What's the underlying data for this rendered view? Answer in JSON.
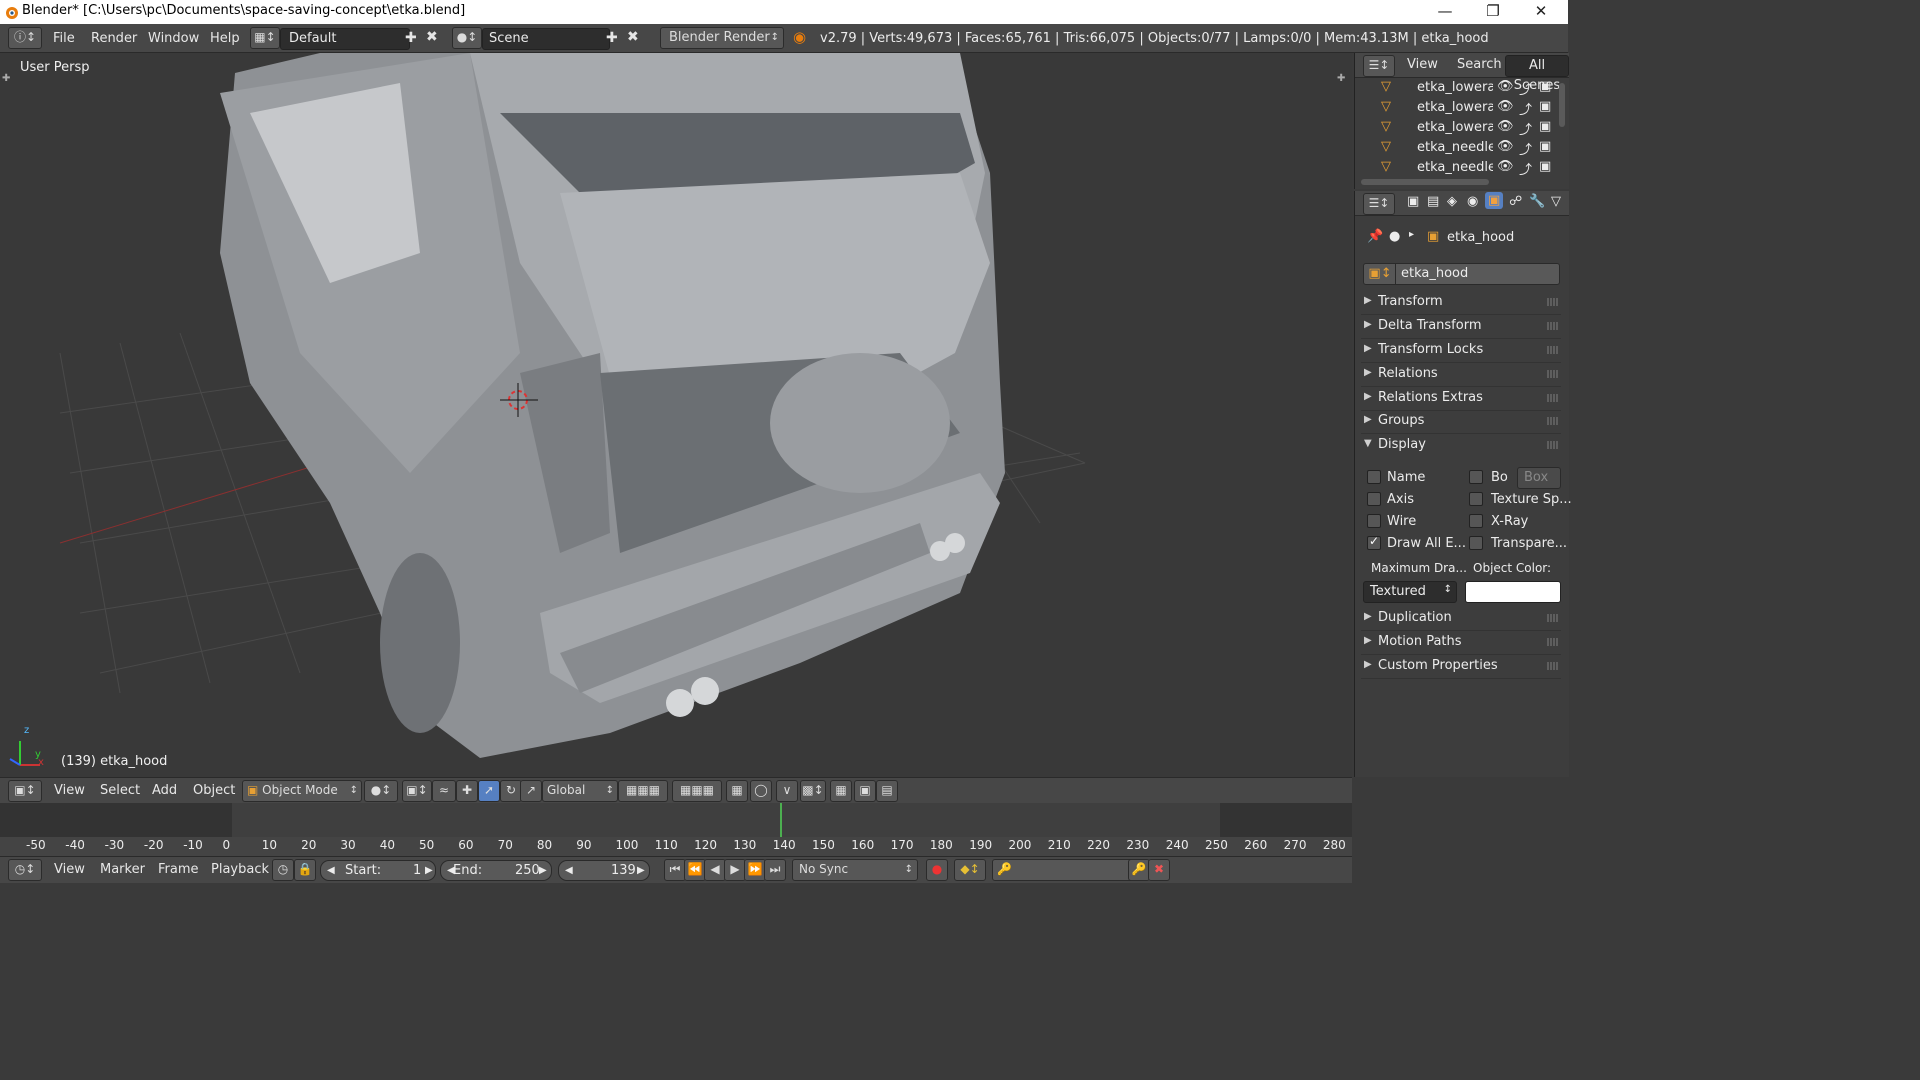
{
  "window": {
    "title": "Blender* [C:\\Users\\pc\\Documents\\space-saving-concept\\etka.blend]",
    "minimize": "—",
    "maximize": "❐",
    "close": "✕"
  },
  "info_header": {
    "menus": [
      "File",
      "Render",
      "Window",
      "Help"
    ],
    "layout": "Default",
    "scene": "Scene",
    "engine": "Blender Render",
    "stats": "v2.79 | Verts:49,673 | Faces:65,761 | Tris:66,075 | Objects:0/77 | Lamps:0/0 | Mem:43.13M | etka_hood"
  },
  "viewport": {
    "view_label": "User Persp",
    "object_label": "(139) etka_hood",
    "axis_x": "x",
    "axis_y": "y",
    "axis_z": "z"
  },
  "outliner": {
    "tabs": [
      "View",
      "Search",
      "All Scenes"
    ],
    "items": [
      "etka_lowerarn",
      "etka_lowerarn",
      "etka_lowerarn",
      "etka_needle_",
      "etka_needle_"
    ]
  },
  "properties": {
    "breadcrumb": "etka_hood",
    "object_name": "etka_hood",
    "panels_top": [
      "Transform",
      "Delta Transform",
      "Transform Locks",
      "Relations",
      "Relations Extras",
      "Groups"
    ],
    "display_panel": "Display",
    "display_left": [
      {
        "label": "Name",
        "checked": false
      },
      {
        "label": "Axis",
        "checked": false
      },
      {
        "label": "Wire",
        "checked": false
      },
      {
        "label": "Draw All E...",
        "checked": true
      }
    ],
    "display_right": [
      {
        "label": "Bo",
        "checked": false
      },
      {
        "label": "Texture Sp...",
        "checked": false
      },
      {
        "label": "X-Ray",
        "checked": false
      },
      {
        "label": "Transpare...",
        "checked": false
      }
    ],
    "bounds_type": "Box",
    "max_draw_label": "Maximum Dra...",
    "max_draw_value": "Textured",
    "object_color_label": "Object Color:",
    "object_color": "#ffffff",
    "panels_bottom": [
      "Duplication",
      "Motion Paths",
      "Custom Properties"
    ]
  },
  "viewport_header": {
    "menus": [
      "View",
      "Select",
      "Add",
      "Object"
    ],
    "mode": "Object Mode",
    "orientation": "Global"
  },
  "timeline": {
    "ticks": [
      "-50",
      "-40",
      "-30",
      "-20",
      "-10",
      "0",
      "10",
      "20",
      "30",
      "40",
      "50",
      "60",
      "70",
      "80",
      "90",
      "100",
      "110",
      "120",
      "130",
      "140",
      "150",
      "160",
      "170",
      "180",
      "190",
      "200",
      "210",
      "220",
      "230",
      "240",
      "250",
      "260",
      "270",
      "280"
    ],
    "menus": [
      "View",
      "Marker",
      "Frame",
      "Playback"
    ],
    "start_label": "Start:",
    "start": "1",
    "end_label": "End:",
    "end": "250",
    "current": "139",
    "sync": "No Sync"
  }
}
